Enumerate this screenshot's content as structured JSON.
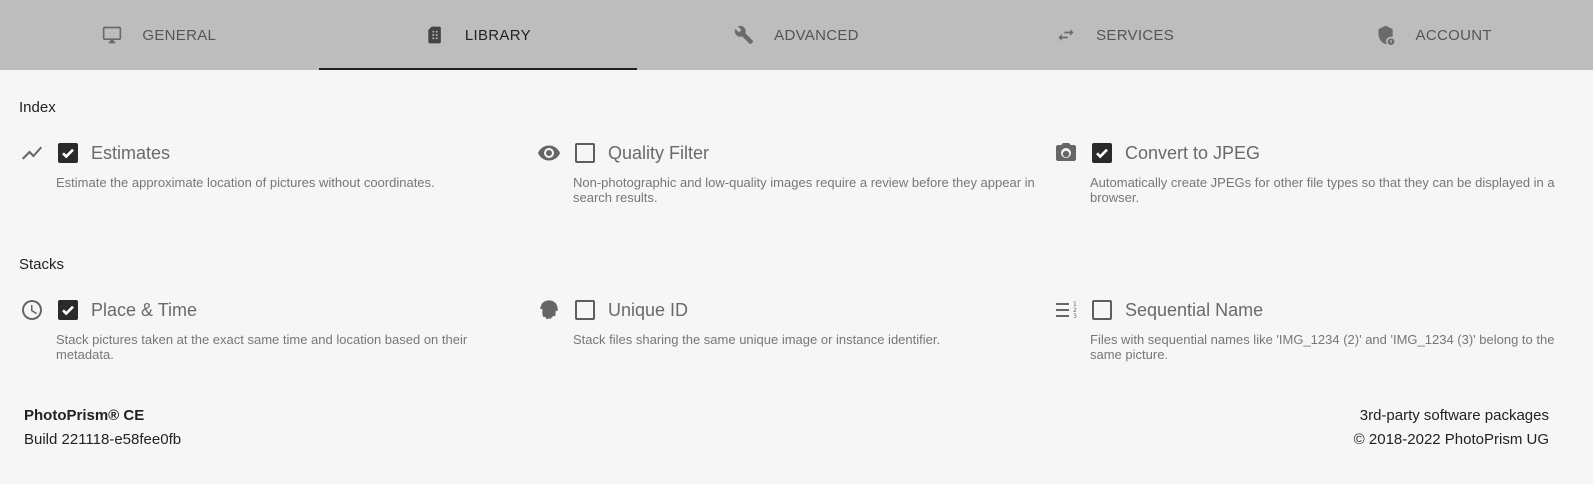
{
  "tabs": [
    {
      "label": "General",
      "icon": "monitor-icon",
      "active": false
    },
    {
      "label": "Library",
      "icon": "film-folder-icon",
      "active": true
    },
    {
      "label": "Advanced",
      "icon": "wrench-icon",
      "active": false
    },
    {
      "label": "Services",
      "icon": "swap-arrows-icon",
      "active": false
    },
    {
      "label": "Account",
      "icon": "shield-account-icon",
      "active": false
    }
  ],
  "index": {
    "title": "Index",
    "options": [
      {
        "label": "Estimates",
        "checked": true,
        "icon": "trend-line-icon",
        "description": "Estimate the approximate location of pictures without coordinates."
      },
      {
        "label": "Quality Filter",
        "checked": false,
        "icon": "eye-icon",
        "description": "Non-photographic and low-quality images require a review before they appear in search results."
      },
      {
        "label": "Convert to JPEG",
        "checked": true,
        "icon": "camera-icon",
        "description": "Automatically create JPEGs for other file types so that they can be displayed in a browser."
      }
    ]
  },
  "stacks": {
    "title": "Stacks",
    "options": [
      {
        "label": "Place & Time",
        "checked": true,
        "icon": "clock-icon",
        "description": "Stack pictures taken at the exact same time and location based on their metadata."
      },
      {
        "label": "Unique ID",
        "checked": false,
        "icon": "fingerprint-icon",
        "description": "Stack files sharing the same unique image or instance identifier."
      },
      {
        "label": "Sequential Name",
        "checked": false,
        "icon": "numbered-list-icon",
        "description": "Files with sequential names like 'IMG_1234 (2)' and 'IMG_1234 (3)' belong to the same picture."
      }
    ]
  },
  "footer": {
    "app_name": "PhotoPrism® CE",
    "build": "Build 221118-e58fee0fb",
    "packages_link": "3rd-party software packages",
    "copyright": "© 2018-2022 PhotoPrism UG"
  },
  "colors": {
    "tab_bar": "#bdbdbd",
    "background": "#f6f6f6",
    "checkbox_checked": "#2a2a2a"
  }
}
